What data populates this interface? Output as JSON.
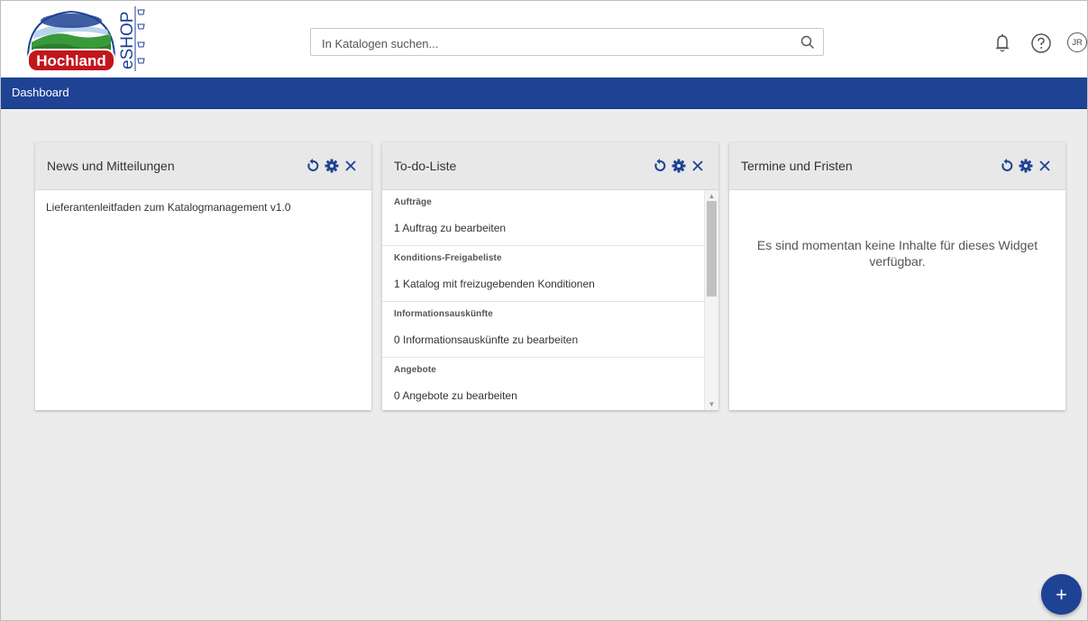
{
  "header": {
    "logo_brand": "Hochland",
    "logo_product": "eSHOP",
    "search_placeholder": "In Katalogen suchen...",
    "user_initials": "JR",
    "icons": [
      "bell-icon",
      "help-icon",
      "avatar"
    ]
  },
  "nav": {
    "breadcrumb": "Dashboard"
  },
  "widgets": {
    "news": {
      "title": "News und Mitteilungen",
      "items": [
        "Lieferantenleitfaden zum Katalogmanagement v1.0"
      ]
    },
    "todo": {
      "title": "To-do-Liste",
      "sections": [
        {
          "category": "Aufträge",
          "item": "1 Auftrag zu bearbeiten"
        },
        {
          "category": "Konditions-Freigabeliste",
          "item": "1 Katalog mit freizugebenden Konditionen"
        },
        {
          "category": "Informationsauskünfte",
          "item": "0 Informationsauskünfte zu bearbeiten"
        },
        {
          "category": "Angebote",
          "item": "0 Angebote zu bearbeiten"
        }
      ]
    },
    "deadlines": {
      "title": "Termine und Fristen",
      "empty_message": "Es sind momentan keine Inhalte für dieses Widget verfügbar."
    }
  },
  "fab_label": "+",
  "colors": {
    "primary": "#1e4294",
    "accent": "#1e4294",
    "logo_red": "#c0171d",
    "background": "#ececec"
  }
}
